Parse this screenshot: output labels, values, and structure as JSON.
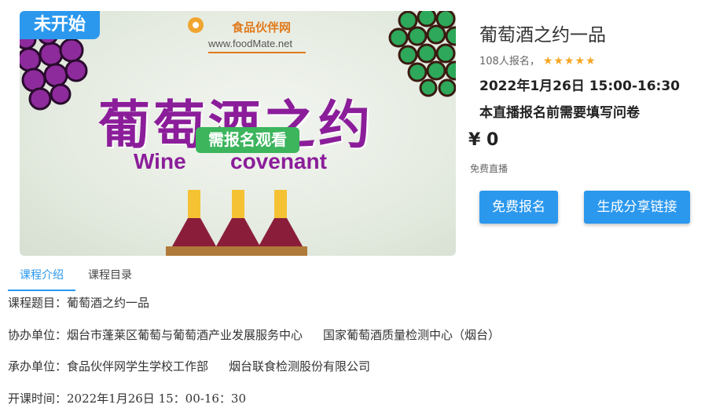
{
  "banner": {
    "status_badge": "未开始",
    "logo_name": "食品伙伴网",
    "logo_url": "www.foodMate.net",
    "title_zh": "葡萄酒之约",
    "need_signup_badge": "需报名观看",
    "title_en_left": "Wine",
    "title_en_right": "covenant"
  },
  "course": {
    "title": "葡萄酒之约一品",
    "enroll_count": "108人报名，",
    "rating_stars": 5,
    "stars_text": "★★★★★",
    "datetime": "2022年1月26日 15:00-16:30",
    "notice": "本直播报名前需要填写问卷",
    "price": "¥ 0",
    "price_note": "免费直播"
  },
  "buttons": {
    "signup": "免费报名",
    "share": "生成分享链接"
  },
  "tabs": [
    {
      "label": "课程介绍",
      "active": true
    },
    {
      "label": "课程目录",
      "active": false
    }
  ],
  "description": {
    "topic": "课程题目：葡萄酒之约一品",
    "co_organizer_label": "协办单位：烟台市蓬莱区葡萄与葡萄酒产业发展服务中心",
    "co_organizer_2": "国家葡萄酒质量检测中心（烟台）",
    "host_label": "承办单位：食品伙伴网学生学校工作部",
    "host_2": "烟台联食检测股份有限公司",
    "start_time": "开课时间：2022年1月26日  15：00-16：30"
  },
  "colors": {
    "accent": "#2b98ee",
    "badge_green": "#3cb55c",
    "title_purple": "#8b1d9a",
    "star": "#f5a623",
    "logo_orange": "#e07a1c"
  }
}
